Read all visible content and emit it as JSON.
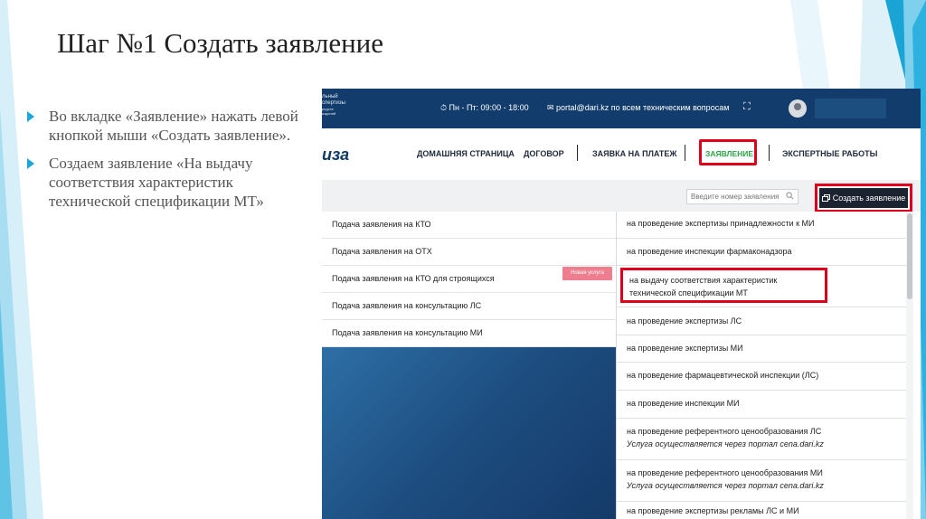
{
  "slide": {
    "title": "Шаг №1 Создать заявление",
    "bullets": [
      "Во вкладке «Заявление» нажать левой кнопкой мыши «Создать заявление».",
      "Создаем заявление «На выдачу соответствия характеристик технической спецификации МТ»"
    ]
  },
  "topbar": {
    "org_line1": "льный",
    "org_line2": "спертизы",
    "org_line3": "редств",
    "org_line4": "изделий",
    "hours": "⏱ Пн - Пт: 09:00 - 18:00",
    "email": "✉ portal@dari.kz по всем техническим вопросам",
    "expand_icon": "⛶"
  },
  "navbar": {
    "logo": "иза",
    "items": [
      "ДОМАШНЯЯ СТРАНИЦА",
      "ДОГОВОР",
      "ЗАЯВКА НА ПЛАТЕЖ",
      "ЗАЯВЛЕНИЕ",
      "ЭКСПЕРТНЫЕ РАБОТЫ"
    ]
  },
  "toolbar": {
    "search_placeholder": "Введите номер заявления",
    "create_button": "Создать заявление"
  },
  "left_menu": {
    "items": [
      "Подача заявления на КТО",
      "Подача заявления на ОТХ",
      "Подача заявления на КТО для строящихся",
      "Подача заявления на консультацию ЛС",
      "Подача заявления на консультацию МИ"
    ],
    "badge": "Новая услуга"
  },
  "right_menu": {
    "items": [
      {
        "text": "на проведение экспертизы принадлежности к МИ"
      },
      {
        "text": "на проведение инспекции фармаконадзора"
      },
      {
        "text": "на выдачу соответствия характеристик технической спецификации МТ",
        "highlighted": true
      },
      {
        "text": "на проведение экспертизы ЛС"
      },
      {
        "text": "на проведение экспертизы МИ"
      },
      {
        "text": "на проведение фармацевтической инспекции (ЛС)"
      },
      {
        "text": "на проведение инспекции МИ"
      },
      {
        "text": "на проведение референтного ценообразования ЛС",
        "sub": "Услуга осуществляется через портал cena.dari.kz"
      },
      {
        "text": "на проведение референтного ценообразования МИ",
        "sub": "Услуга осуществляется через портал cena.dari.kz"
      },
      {
        "text": "на проведение экспертизы рекламы ЛС и МИ"
      }
    ]
  },
  "colors": {
    "accent_blue": "#1ca7d8",
    "highlight_red": "#e0001b",
    "active_green": "#27a845",
    "header_navy": "#123c6b"
  }
}
